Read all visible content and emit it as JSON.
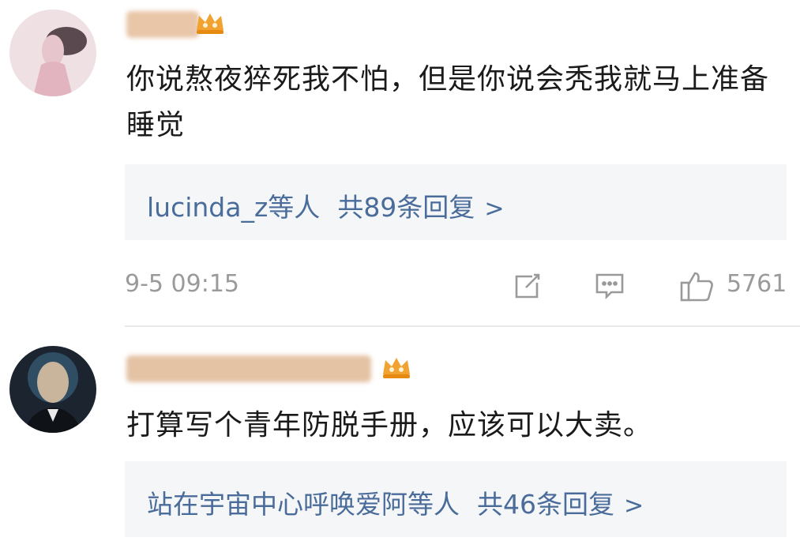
{
  "comments": [
    {
      "avatar": "avatar-pink-silhouette",
      "username_visible": "",
      "badge": "crown-icon",
      "text": "你说熬夜猝死我不怕，但是你说会秃我就马上准备睡觉",
      "replies": {
        "users": "lucinda_z等人",
        "count": "共89条回复",
        "arrow": ">"
      },
      "timestamp": "9-5 09:15",
      "icons": [
        "share-icon",
        "comment-icon",
        "like-icon"
      ],
      "likes": "5761"
    },
    {
      "avatar": "avatar-bald-man",
      "username_visible": "",
      "badge": "crown-icon",
      "text": "打算写个青年防脱手册，应该可以大卖。",
      "replies": {
        "users": "站在宇宙中心呼唤爱阿等人",
        "count": "共46条回复",
        "arrow": ">"
      }
    }
  ],
  "colors": {
    "link": "#4a6c9a",
    "meta": "#9a9a9a",
    "reply_bg": "#f5f6f8",
    "crown": "#f2a230"
  }
}
